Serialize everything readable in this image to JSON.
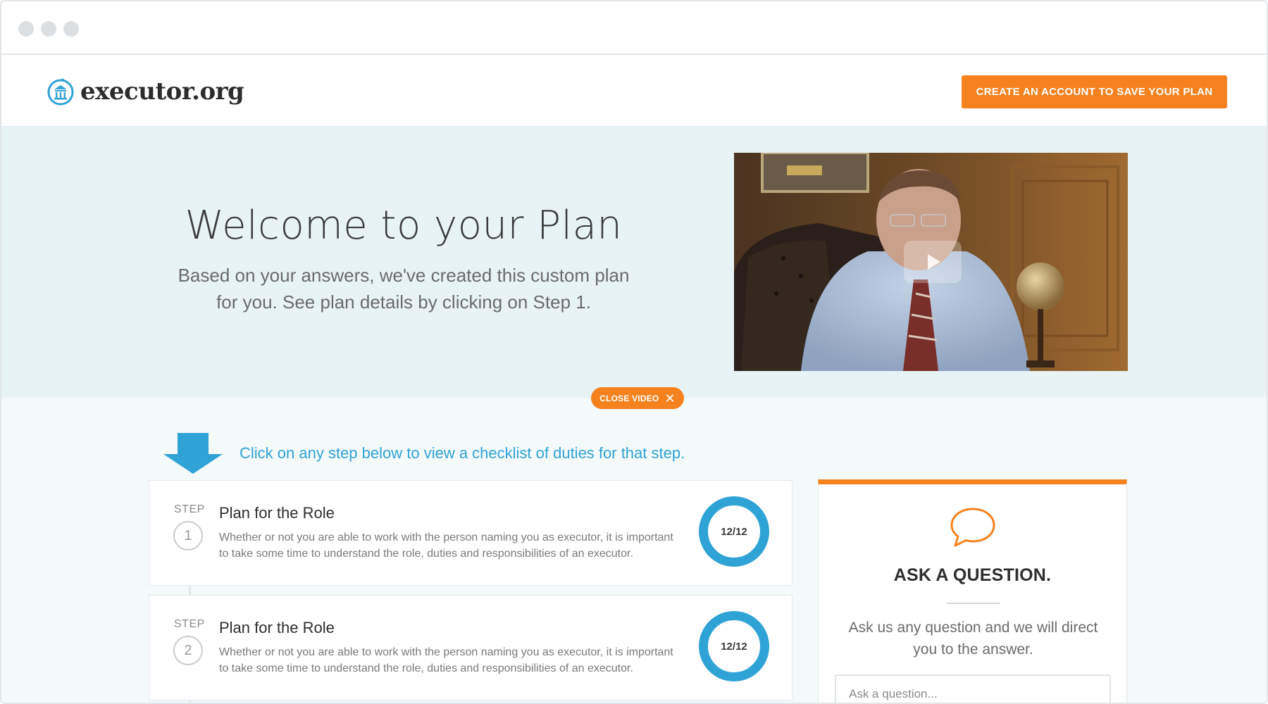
{
  "header": {
    "logo_text": "executor.org",
    "cta_label": "CREATE AN ACCOUNT TO SAVE YOUR PLAN"
  },
  "hero": {
    "title": "Welcome to your Plan",
    "subtitle_line1": "Based on your answers, we've created this custom plan",
    "subtitle_line2": "for you. See plan details by clicking on Step 1."
  },
  "video": {
    "close_label": "CLOSE VIDEO"
  },
  "hint": {
    "text": "Click on any step below to view a checklist of duties for that step."
  },
  "steps": [
    {
      "label": "STEP",
      "number": "1",
      "title": "Plan for the Role",
      "description": "Whether or not you are able to work with the person naming you as executor, it is important to take some time to understand the role, duties and responsibilities of an executor.",
      "progress": "12/12"
    },
    {
      "label": "STEP",
      "number": "2",
      "title": "Plan for the Role",
      "description": "Whether or not you are able to work with the person naming you as executor, it is important to take some time to understand the role, duties and responsibilities of an executor.",
      "progress": "12/12"
    }
  ],
  "ask": {
    "title": "ASK A QUESTION.",
    "text": "Ask us any question and we will direct you to the answer.",
    "input_placeholder": "Ask a question..."
  },
  "colors": {
    "accent_orange": "#f5821f",
    "accent_blue": "#2fa3d6",
    "hero_bg": "#e8f3f6"
  },
  "icons": {
    "logo": "bank-building-icon",
    "play": "play-icon",
    "close": "close-icon",
    "hint": "arrow-down-icon",
    "ask": "speech-bubble-icon"
  }
}
